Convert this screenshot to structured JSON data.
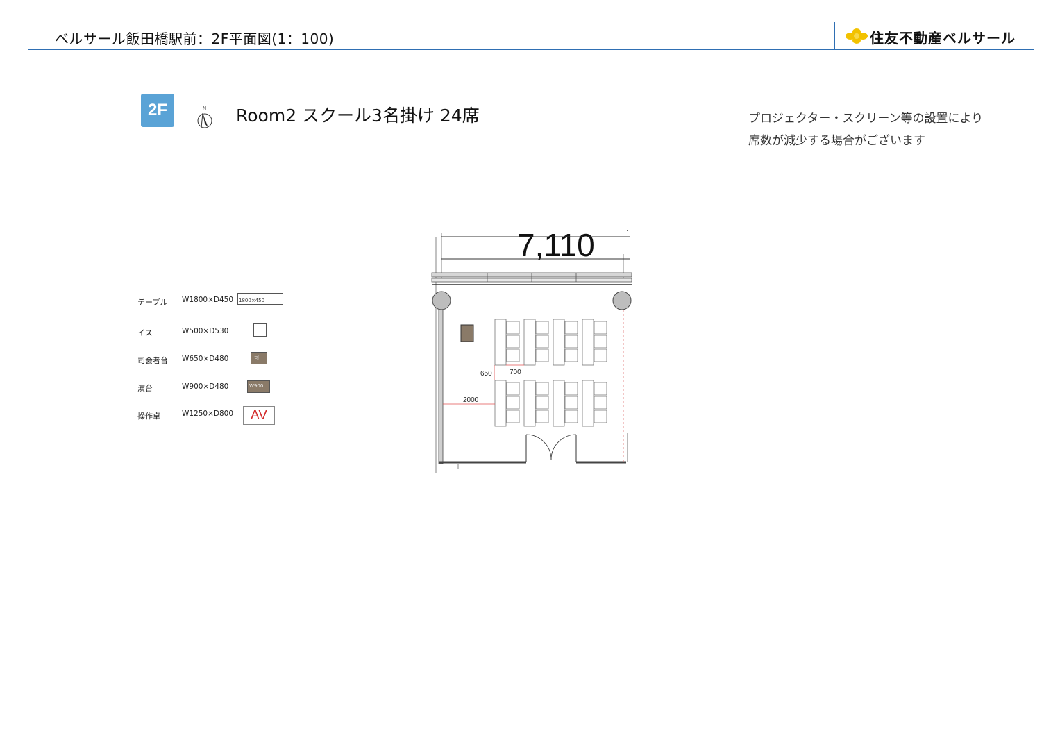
{
  "header": {
    "title": "ベルサール飯田橋駅前：2F平面図(1：100)",
    "brand": "住友不動産ベルサール",
    "brand_color": "#f2c200",
    "border_color": "#2f6fb3"
  },
  "floor_badge": "2F",
  "north_label": "N",
  "room_title": "Room2 スクール3名掛け 24席",
  "note_lines": [
    "プロジェクター・スクリーン等の設置により",
    "席数が減少する場合がございます"
  ],
  "legend": [
    {
      "label": "テーブル",
      "dims": "W1800×D450",
      "symbol_text": "1800×450"
    },
    {
      "label": "イス",
      "dims": "W500×D530",
      "symbol_text": ""
    },
    {
      "label": "司会者台",
      "dims": "W650×D480",
      "symbol_text": "司"
    },
    {
      "label": "演台",
      "dims": "W900×D480",
      "symbol_text": "W900"
    },
    {
      "label": "操作卓",
      "dims": "W1250×D800",
      "symbol_text": "AV"
    }
  ],
  "plan": {
    "overall_width": "7,110",
    "dim_650": "650",
    "dim_700": "700",
    "dim_2000": "2000"
  }
}
